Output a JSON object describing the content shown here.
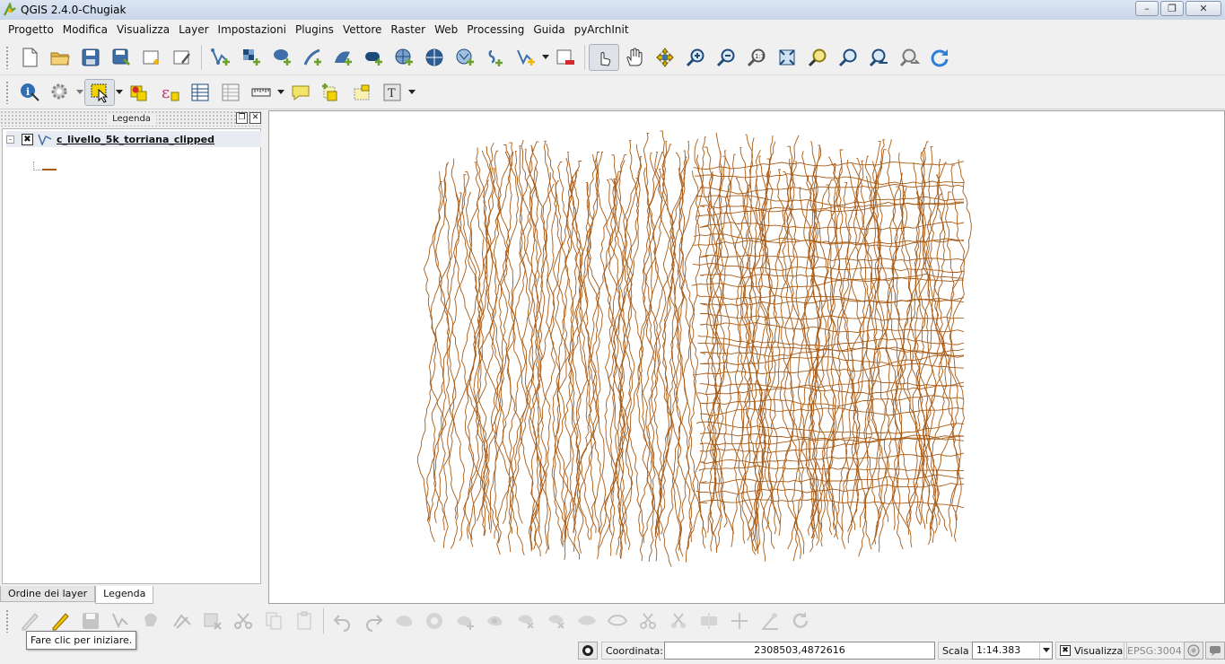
{
  "window": {
    "title": "QGIS 2.4.0-Chugiak",
    "controls": [
      "minimize",
      "maximize",
      "close"
    ]
  },
  "menubar": {
    "items": [
      "Progetto",
      "Modifica",
      "Visualizza",
      "Layer",
      "Impostazioni",
      "Plugins",
      "Vettore",
      "Raster",
      "Web",
      "Processing",
      "Guida",
      "pyArchInit"
    ]
  },
  "legend_panel": {
    "title": "Legenda",
    "layers": [
      {
        "name": "c_livello_5k_torriana_clipped",
        "visible": true,
        "symbol_color": "#a85b16"
      }
    ],
    "tabs": [
      "Ordine dei layer",
      "Legenda"
    ],
    "active_tab": "Legenda"
  },
  "map": {
    "contour_color": "#a85b16",
    "background": "#ffffff"
  },
  "tooltip": "Fare clic per iniziare.",
  "statusbar": {
    "coord_label": "Coordinata:",
    "coord_value": "2308503,4872616",
    "scale_label": "Scala",
    "scale_value": "1:14.383",
    "render_label": "Visualizza",
    "render_checked": true,
    "crs": "EPSG:3004"
  },
  "icons": {
    "toolbar1": [
      "new-project-icon",
      "open-project-icon",
      "save-project-icon",
      "save-as-icon",
      "new-print-composer-icon",
      "composer-manager-icon",
      "add-vector-layer-icon",
      "add-raster-layer-icon",
      "add-postgis-layer-icon",
      "add-spatialite-layer-icon",
      "add-mssql-layer-icon",
      "add-oracle-layer-icon",
      "add-wms-layer-icon",
      "add-wcs-layer-icon",
      "add-wfs-layer-icon",
      "add-delimited-text-icon",
      "new-shapefile-icon",
      "remove-layer-icon",
      "touch-pan-icon",
      "pan-icon",
      "pan-to-selection-icon",
      "zoom-in-icon",
      "zoom-out-icon",
      "zoom-actual-icon",
      "zoom-full-icon",
      "zoom-to-selection-icon",
      "zoom-to-layer-icon",
      "zoom-last-icon",
      "zoom-next-icon",
      "refresh-icon"
    ],
    "toolbar2": [
      "identify-icon",
      "run-action-icon",
      "select-features-icon",
      "deselect-icon",
      "field-calculator-icon",
      "attribute-table-icon",
      "statistics-icon",
      "measure-icon",
      "map-tips-icon",
      "new-bookmark-icon",
      "show-bookmarks-icon",
      "text-annotation-icon"
    ],
    "toolbar3": [
      "current-edits-icon",
      "toggle-editing-icon",
      "save-edits-icon",
      "add-feature-icon",
      "move-feature-icon",
      "node-tool-icon",
      "delete-selected-icon",
      "cut-features-icon",
      "copy-features-icon",
      "paste-features-icon",
      "undo-icon",
      "redo-icon",
      "simplify-feature-icon",
      "add-ring-icon",
      "add-part-icon",
      "fill-ring-icon",
      "delete-ring-icon",
      "delete-part-icon",
      "reshape-icon",
      "offset-curve-icon",
      "split-features-icon",
      "split-parts-icon",
      "merge-features-icon",
      "merge-attributes-icon",
      "rotate-point-symbols-icon",
      "rotate-feature-icon"
    ]
  }
}
